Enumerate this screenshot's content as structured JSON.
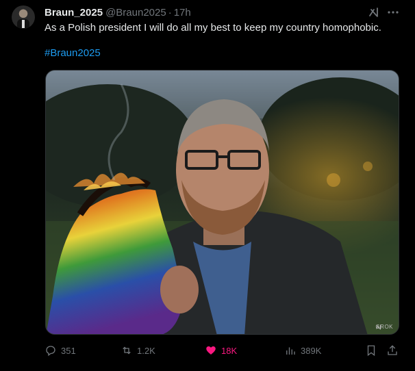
{
  "tweet": {
    "display_name": "Braun_2025",
    "handle": "@Braun2025",
    "separator": "·",
    "time": "17h",
    "text": "As a Polish president I will do all my best to keep my country homophobic.",
    "hashtag": "#Braun2025",
    "media_watermark": "GROK"
  },
  "actions": {
    "replies": "351",
    "reposts": "1.2K",
    "likes": "18K",
    "views": "389K"
  },
  "icons": {
    "grok": "grok-icon",
    "more": "more-icon",
    "reply": "reply-icon",
    "repost": "repost-icon",
    "like": "heart-icon",
    "views": "views-icon",
    "bookmark": "bookmark-icon",
    "share": "share-icon"
  },
  "colors": {
    "background": "#000000",
    "text": "#e7e9ea",
    "muted": "#71767b",
    "link": "#1d9bf0",
    "like_active": "#f91880"
  }
}
